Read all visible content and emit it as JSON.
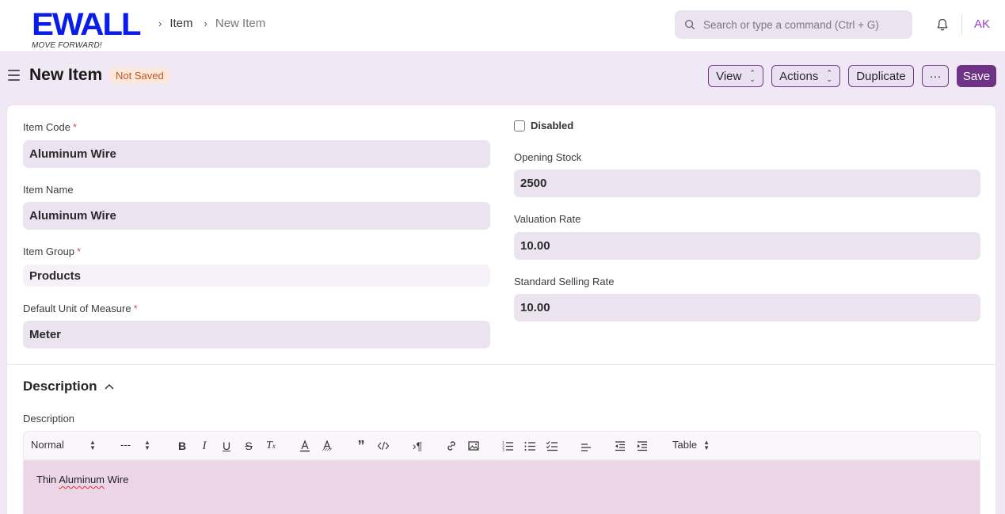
{
  "logo": {
    "name": "EWALL",
    "tagline": "MOVE FORWARD!"
  },
  "breadcrumb": [
    {
      "label": "Item"
    },
    {
      "label": "New Item"
    }
  ],
  "search": {
    "placeholder": "Search or type a command (Ctrl + G)"
  },
  "user": {
    "initials": "AK"
  },
  "page": {
    "title": "New Item",
    "status": "Not Saved",
    "buttons": {
      "view": "View",
      "actions": "Actions",
      "duplicate": "Duplicate",
      "more": "···",
      "save": "Save"
    }
  },
  "form": {
    "item_code": {
      "label": "Item Code",
      "value": "Aluminum Wire",
      "required": "*"
    },
    "item_name": {
      "label": "Item Name",
      "value": "Aluminum Wire"
    },
    "item_group": {
      "label": "Item Group",
      "value": "Products",
      "required": "*"
    },
    "uom": {
      "label": "Default Unit of Measure",
      "value": "Meter",
      "required": "*"
    },
    "disabled": {
      "label": "Disabled",
      "checked": false
    },
    "opening_stock": {
      "label": "Opening Stock",
      "value": "2500"
    },
    "valuation_rate": {
      "label": "Valuation Rate",
      "value": "10.00"
    },
    "standard_selling_rate": {
      "label": "Standard Selling Rate",
      "value": "10.00"
    }
  },
  "description_section": {
    "title": "Description",
    "field_label": "Description",
    "toolbar": {
      "text_style": "Normal",
      "font_size": "---",
      "table": "Table"
    },
    "content": {
      "word1": "Thin",
      "word2": "Aluminum",
      "word3": "Wire"
    }
  },
  "colors": {
    "brand": "#0a1de8",
    "primary": "#6e3384",
    "avatar": "#9b3fd0",
    "not_saved": "#c1561b"
  }
}
